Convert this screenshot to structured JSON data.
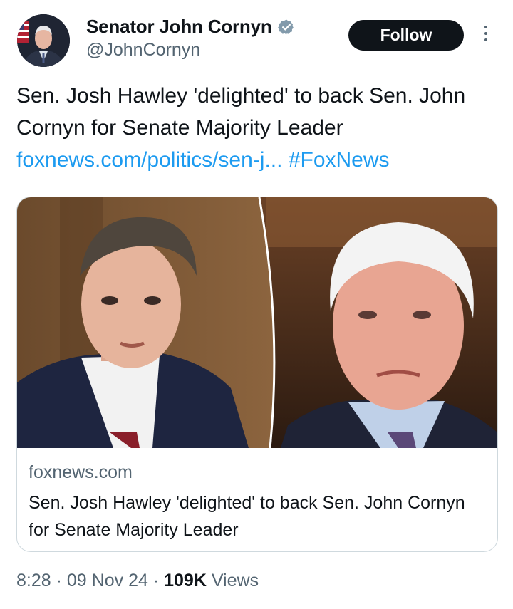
{
  "author": {
    "display_name": "Senator John Cornyn",
    "handle": "@JohnCornyn",
    "verified_icon": "verified-badge-icon"
  },
  "follow_label": "Follow",
  "tweet": {
    "text": "Sen. Josh Hawley 'delighted' to back Sen. John Cornyn for Senate Majority Leader",
    "link_text": "foxnews.com/politics/sen-j...",
    "hashtag": "#FoxNews"
  },
  "card": {
    "domain": "foxnews.com",
    "title": "Sen. Josh Hawley 'delighted' to back Sen. John Cornyn for Senate Majority Leader"
  },
  "meta": {
    "time": "8:28",
    "date": "09 Nov 24",
    "views_count": "109K",
    "views_label": "Views"
  },
  "colors": {
    "link": "#1d9bf0",
    "secondary_text": "#536471",
    "follow_bg": "#0f1419",
    "verified": "#829aab"
  }
}
